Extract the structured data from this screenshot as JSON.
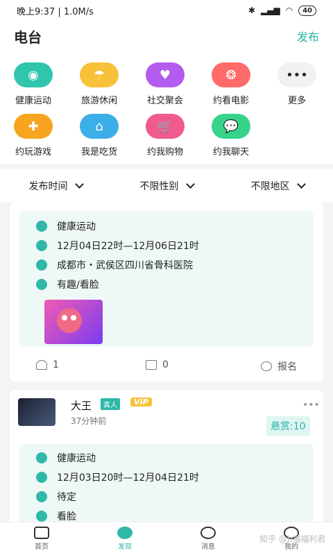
{
  "status": {
    "time": "晚上9:37 | 1.0M/s",
    "battery": "40"
  },
  "header": {
    "title": "电台",
    "publish": "发布"
  },
  "categories": [
    {
      "label": "健康运动",
      "color": "#2fc6ad"
    },
    {
      "label": "旅游休闲",
      "color": "#f7c23a"
    },
    {
      "label": "社交聚会",
      "color": "#b35cf0"
    },
    {
      "label": "约看电影",
      "color": "#ff6a6a"
    },
    {
      "label": "更多",
      "color": "#f1f1f1"
    },
    {
      "label": "约玩游戏",
      "color": "#f7a521"
    },
    {
      "label": "我是吃货",
      "color": "#3dafe8"
    },
    {
      "label": "约我购物",
      "color": "#f05a8d"
    },
    {
      "label": "约我聊天",
      "color": "#37d38b"
    }
  ],
  "filters": {
    "time": "发布时间",
    "gender": "不限性别",
    "region": "不限地区"
  },
  "card1": {
    "category": "健康运动",
    "datetime": "12月04日22时—12月06日21时",
    "location": "成都市・武侯区四川省骨科医院",
    "tags": "有趣/看脸",
    "likes": "1",
    "comments": "0",
    "signup": "报名"
  },
  "card2": {
    "user": {
      "name": "大王",
      "badge_real": "真人",
      "badge_vip": "VIP",
      "time": "37分钟前"
    },
    "reward": "悬赏:10",
    "category": "健康运动",
    "datetime": "12月03日20时—12月04日21时",
    "location": "待定",
    "tags": "看脸"
  },
  "tabs": {
    "home": "首页",
    "discover": "发现",
    "messages": "消息",
    "mine": "我的"
  },
  "watermark": "知乎 @h福福利君"
}
